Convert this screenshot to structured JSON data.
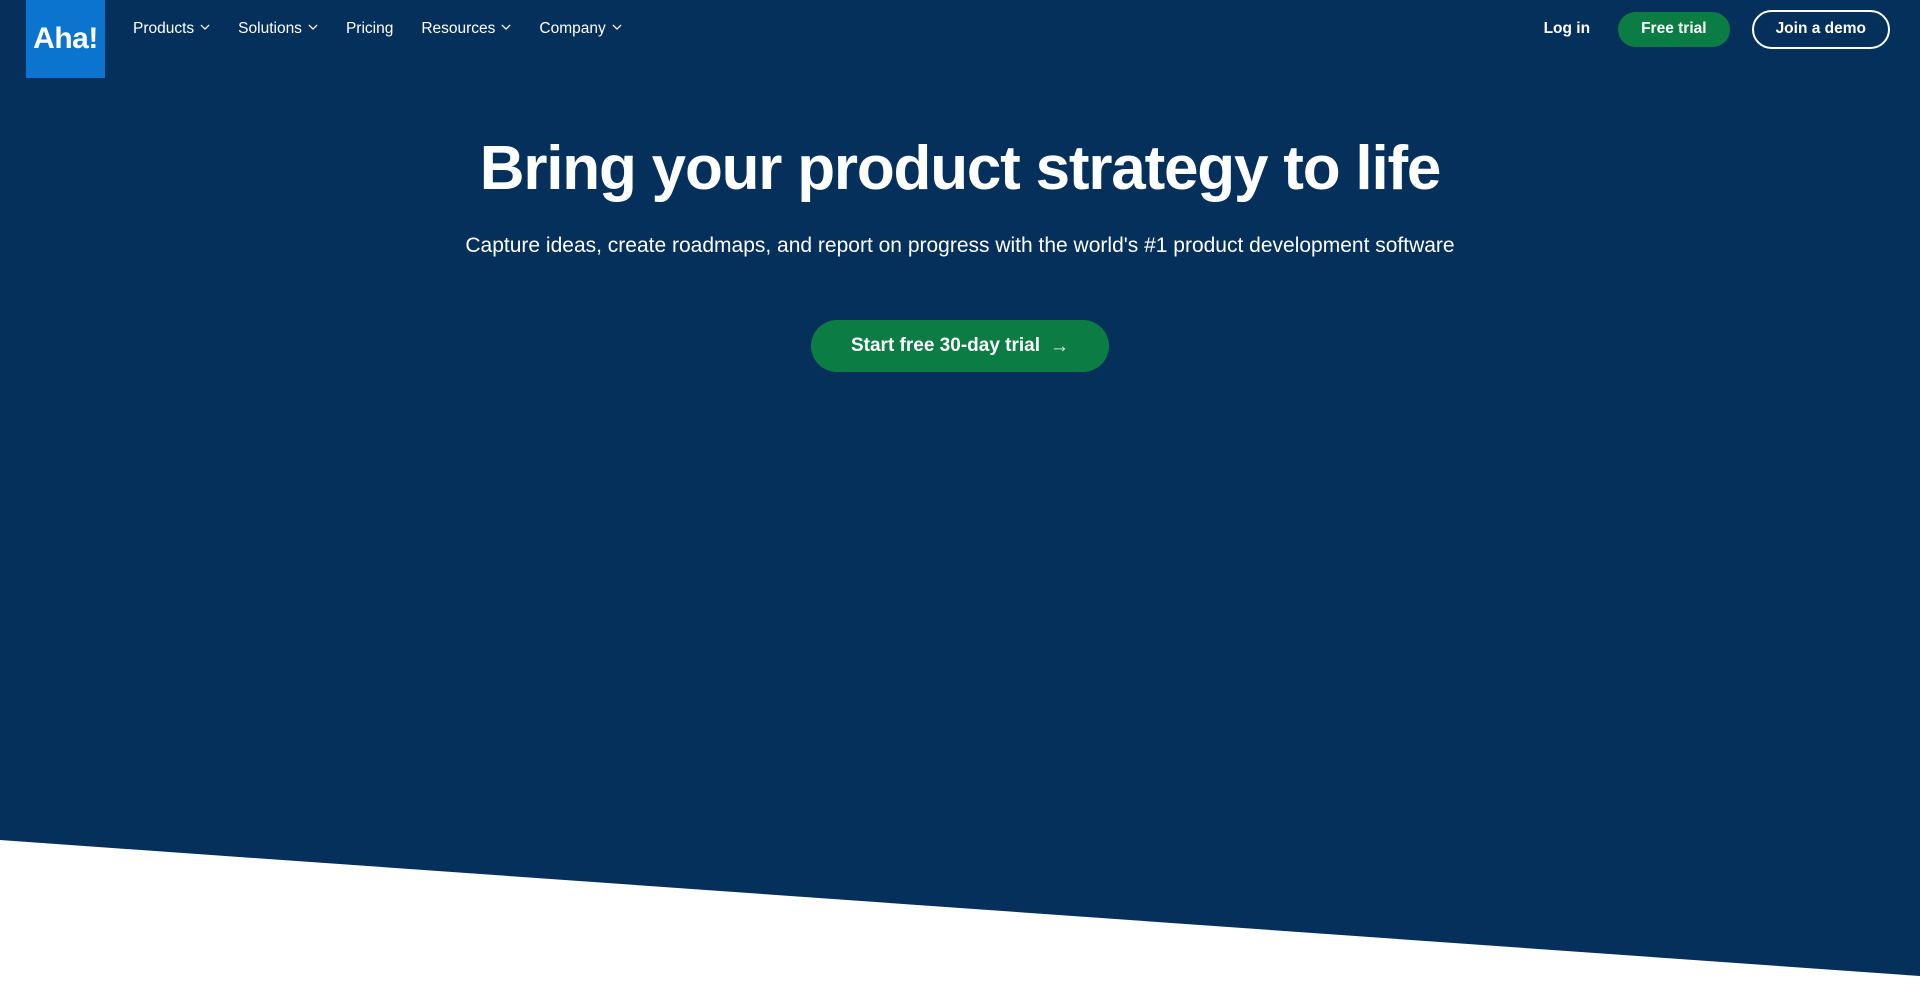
{
  "colors": {
    "hero_background": "#04305B",
    "logo_blue": "#0B74CE",
    "accent_green": "#0B7D44",
    "text_white": "#FFFFFF",
    "page_white": "#FFFFFF"
  },
  "header": {
    "logo_text": "Aha!",
    "nav_items": [
      {
        "label": "Products",
        "has_dropdown": true
      },
      {
        "label": "Solutions",
        "has_dropdown": true
      },
      {
        "label": "Pricing",
        "has_dropdown": false
      },
      {
        "label": "Resources",
        "has_dropdown": true
      },
      {
        "label": "Company",
        "has_dropdown": true
      }
    ],
    "login_label": "Log in",
    "free_trial_label": "Free trial",
    "join_demo_label": "Join a demo"
  },
  "hero": {
    "title": "Bring your product strategy to life",
    "subtitle": "Capture ideas, create roadmaps, and report on progress with the world's #1 product development software",
    "cta_label": "Start free 30-day trial",
    "cta_arrow": "→"
  }
}
